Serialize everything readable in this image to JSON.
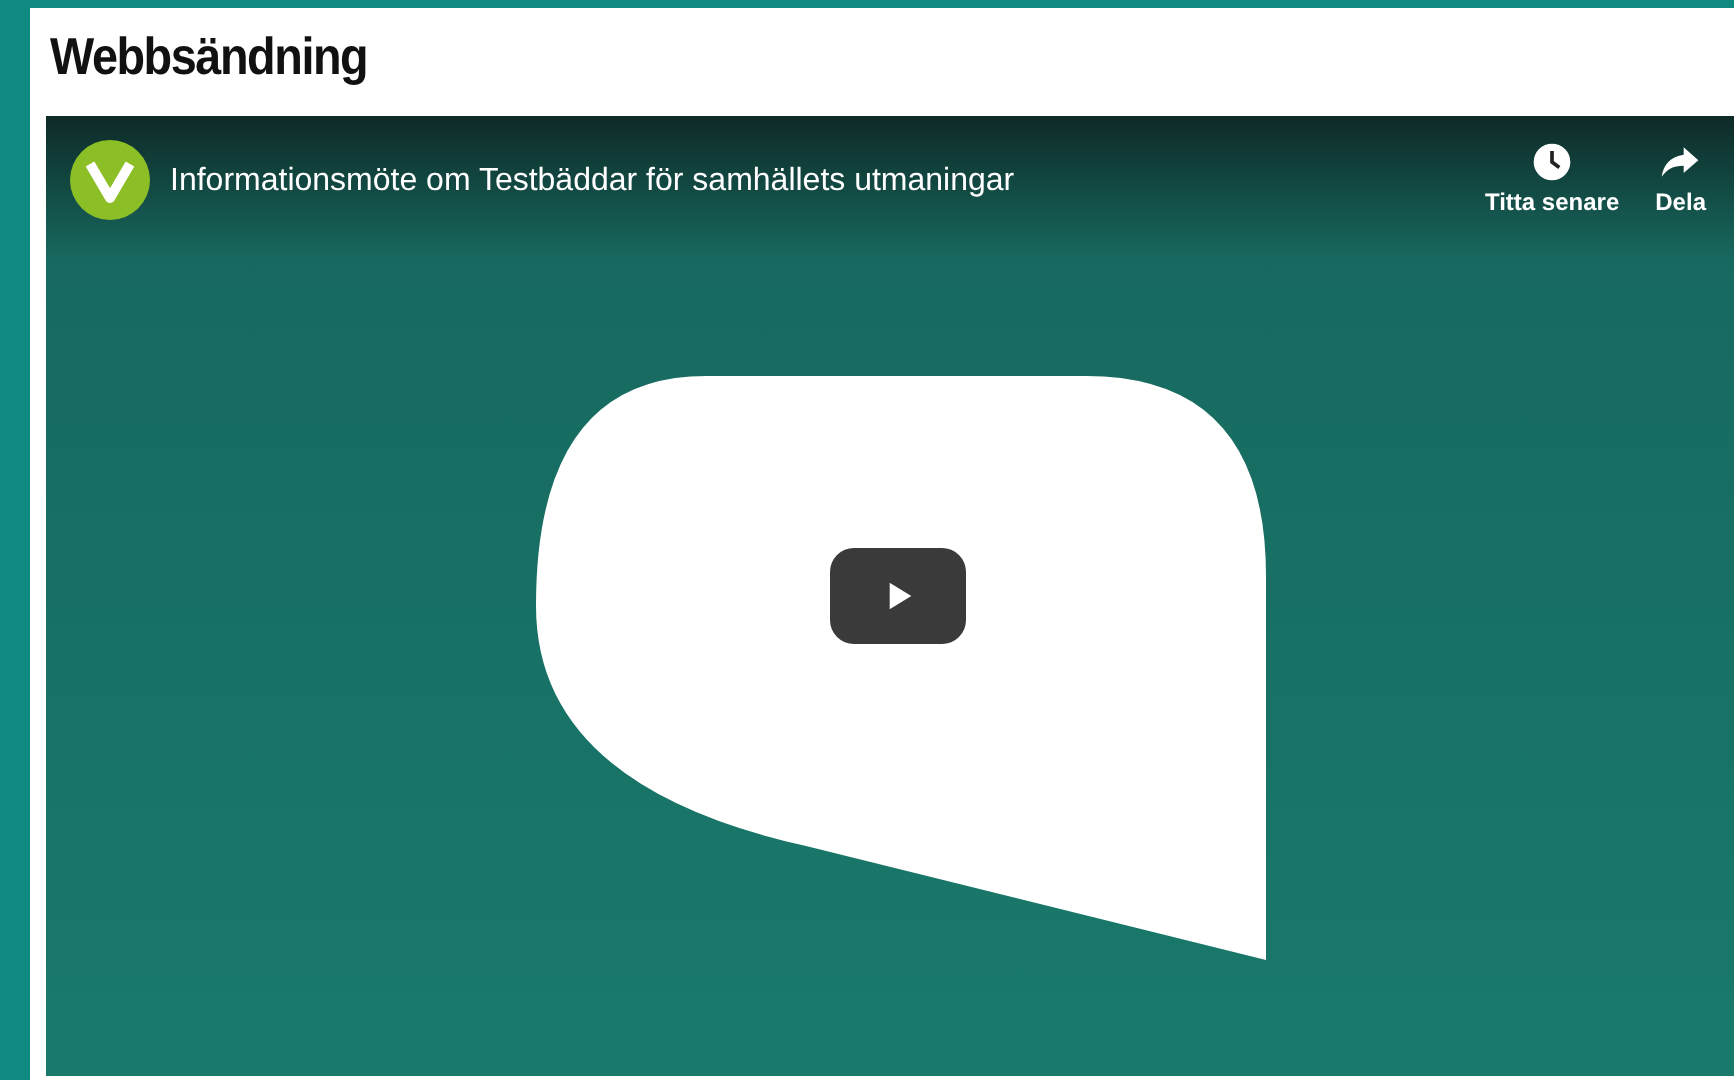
{
  "section": {
    "heading": "Webbsändning"
  },
  "video_player": {
    "title": "Informationsmöte om Testbäddar för samhällets utmaningar",
    "actions": [
      {
        "kind": "watch_later",
        "label": "Titta senare"
      },
      {
        "kind": "share",
        "label": "Dela"
      }
    ]
  }
}
